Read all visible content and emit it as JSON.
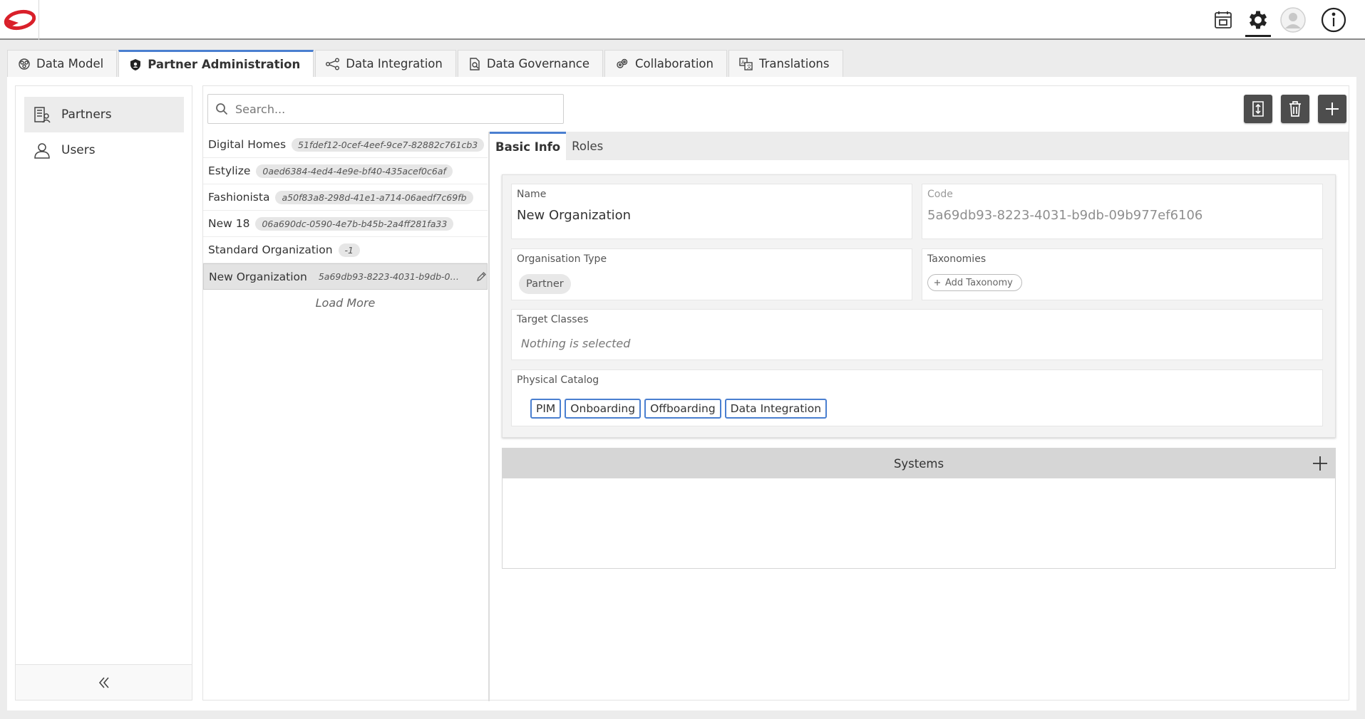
{
  "header": {
    "icons": [
      "calendar-icon",
      "settings-icon",
      "user-avatar-icon",
      "info-icon"
    ]
  },
  "main_tabs": [
    {
      "label": "Data Model",
      "icon": "data-model-icon"
    },
    {
      "label": "Partner Administration",
      "icon": "shield-icon",
      "active": true
    },
    {
      "label": "Data Integration",
      "icon": "integration-icon"
    },
    {
      "label": "Data Governance",
      "icon": "governance-icon"
    },
    {
      "label": "Collaboration",
      "icon": "collaboration-icon"
    },
    {
      "label": "Translations",
      "icon": "translations-icon"
    }
  ],
  "leftnav": {
    "partners": "Partners",
    "users": "Users"
  },
  "search": {
    "placeholder": "Search..."
  },
  "partners": [
    {
      "name": "Digital Homes",
      "id": "51fdef12-0cef-4eef-9ce7-82882c761cb3"
    },
    {
      "name": "Estylize",
      "id": "0aed6384-4ed4-4e9e-bf40-435acef0c6af"
    },
    {
      "name": "Fashionista",
      "id": "a50f83a8-298d-41e1-a714-06aedf7c69fb"
    },
    {
      "name": "New 18",
      "id": "06a690dc-0590-4e7b-b45b-2a4ff281fa33"
    },
    {
      "name": "Standard Organization",
      "id": "-1"
    },
    {
      "name": "New Organization",
      "id": "5a69db93-8223-4031-b9db-09b977ef..."
    }
  ],
  "load_more": "Load More",
  "subtabs": {
    "basic_info": "Basic Info",
    "roles": "Roles"
  },
  "form": {
    "name_label": "Name",
    "name_value": "New Organization",
    "code_label": "Code",
    "code_value": "5a69db93-8223-4031-b9db-09b977ef6106",
    "org_type_label": "Organisation Type",
    "org_type_value": "Partner",
    "taxonomies_label": "Taxonomies",
    "add_taxonomy": "Add Taxonomy",
    "target_classes_label": "Target Classes",
    "target_classes_placeholder": "Nothing is selected",
    "physical_catalog_label": "Physical Catalog",
    "catalogs": [
      "PIM",
      "Onboarding",
      "Offboarding",
      "Data Integration"
    ]
  },
  "systems": {
    "title": "Systems"
  },
  "colors": {
    "accent": "#4a7fd0",
    "logo_red": "#d9202a",
    "action_button": "#4d4d4d"
  }
}
